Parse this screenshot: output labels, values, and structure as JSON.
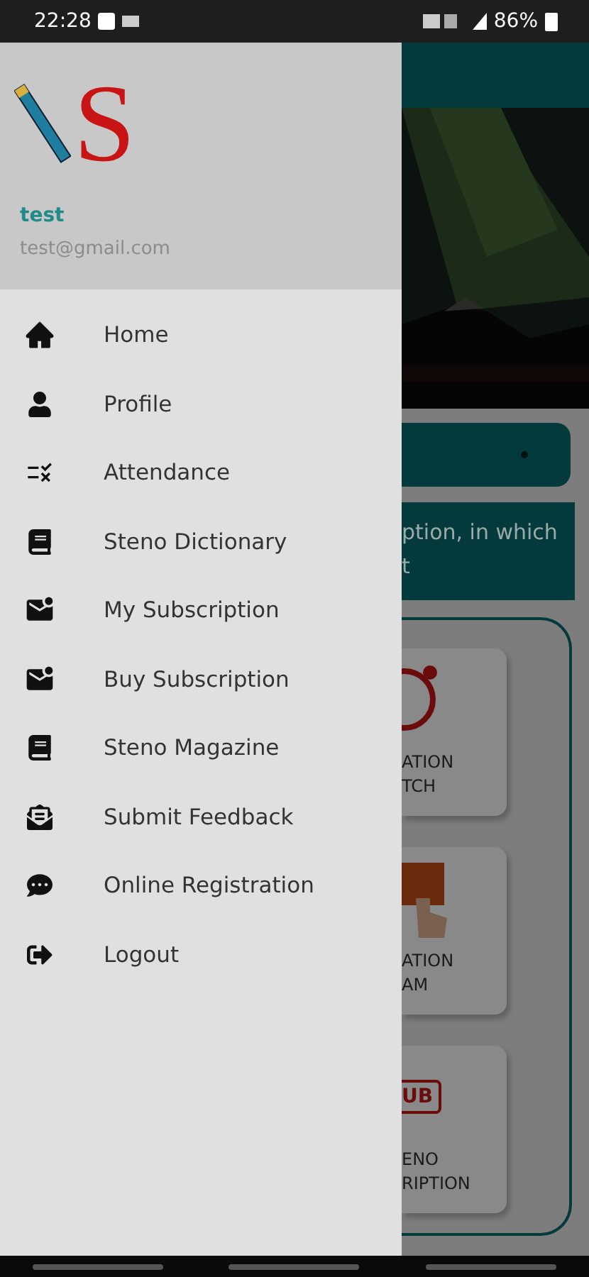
{
  "status_bar": {
    "time": "22:28",
    "battery": "86%"
  },
  "drawer": {
    "logo_letter": "S",
    "user_name": "test",
    "user_email": "test@gmail.com",
    "items": [
      {
        "label": "Home"
      },
      {
        "label": "Profile"
      },
      {
        "label": "Attendance"
      },
      {
        "label": "Steno Dictionary"
      },
      {
        "label": "My Subscription"
      },
      {
        "label": "Buy Subscription"
      },
      {
        "label": "Steno Magazine"
      },
      {
        "label": "Submit Feedback"
      },
      {
        "label": "Online Registration"
      },
      {
        "label": "Logout"
      }
    ]
  },
  "background": {
    "notice_lines": [
      "ption, in which",
      "t"
    ],
    "cards": [
      {
        "lines": [
          "ATION",
          "TCH"
        ]
      },
      {
        "lines": [
          "ATION",
          "AM"
        ]
      },
      {
        "badge": "UB",
        "lines": [
          "ENO",
          "RIPTION"
        ]
      }
    ]
  }
}
